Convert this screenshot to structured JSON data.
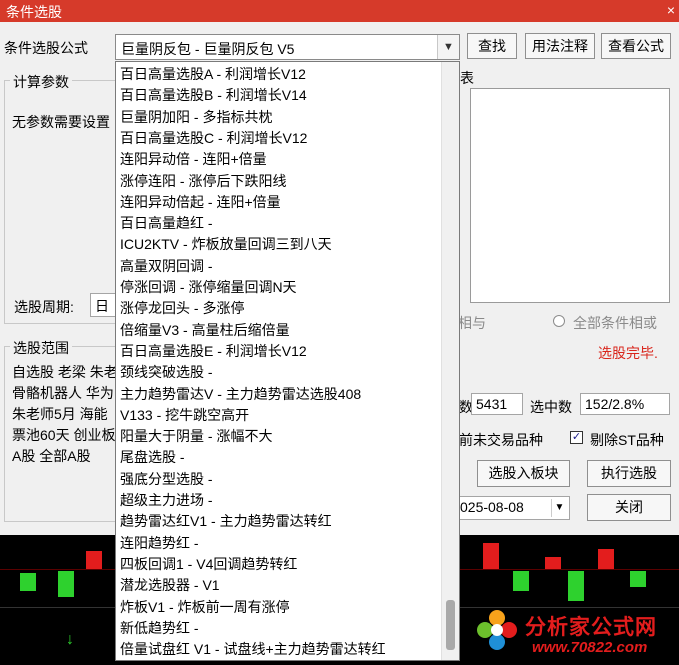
{
  "window": {
    "title": "条件选股",
    "close_glyph": "×"
  },
  "formula": {
    "label": "条件选股公式",
    "selected": "巨量阴反包  -  巨量阴反包 V5",
    "find_button": "查找",
    "usage_button": "用法注释",
    "view_button": "查看公式"
  },
  "params": {
    "group_title": "计算参数",
    "no_params_text": "无参数需要设置",
    "tail_char": "表"
  },
  "period": {
    "label": "选股周期:",
    "value": "日线"
  },
  "condition_mode": {
    "and_label": "相与",
    "or_label": "全部条件相或"
  },
  "status": {
    "done_text": "选股完毕."
  },
  "range": {
    "group_title": "选股范围",
    "rows": [
      "自选股  老梁  朱老",
      "骨骼机器人  华为",
      "朱老师5月  海能",
      "票池60天  创业板",
      "A股  全部A股"
    ]
  },
  "stats": {
    "total_label": "数",
    "total_value": "5431",
    "selected_label": "选中数",
    "selected_value": "152/2.8%"
  },
  "options": {
    "exclude_untraded_label": "前未交易品种",
    "exclude_st_label": "剔除ST品种",
    "exclude_st_checked": "✓"
  },
  "actions": {
    "add_to_block": "选股入板块",
    "run": "执行选股",
    "close": "关闭"
  },
  "date": {
    "value": "025-08-08"
  },
  "dropdown": {
    "items": [
      "百日高量选股A  -  利润增长V12",
      "百日高量选股B  -  利润增长V14",
      "巨量阴加阳  -  多指标共枕",
      "百日高量选股C  -  利润增长V12",
      "连阳异动倍  -  连阳+倍量",
      "涨停连阳  -  涨停后下跌阳线",
      "连阳异动倍起  -  连阳+倍量",
      "百日高量趋红  -",
      "ICU2KTV  -  炸板放量回调三到八天",
      "高量双阴回调  -",
      "停涨回调  -  涨停缩量回调N天",
      "涨停龙回头  -  多涨停",
      "倍缩量V3  -  高量柱后缩倍量",
      "百日高量选股E  -  利润增长V12",
      "颈线突破选股  -",
      "主力趋势雷达V  -  主力趋势雷达选股408",
      "V133  -  挖牛跳空高开",
      "阳量大于阴量  -  涨幅不大",
      "尾盘选股  -",
      "强底分型选股  -",
      "超级主力进场  -",
      "趋势雷达红V1  -  主力趋势雷达转红",
      "连阳趋势红  -",
      "四板回调1  -  V4回调趋势转红",
      "潜龙选股器  -  V1",
      "炸板V1  -  炸板前一周有涨停",
      "新低趋势红  -",
      "倍量试盘红 V1  -  试盘线+主力趋势雷达转红"
    ]
  },
  "watermark": {
    "brand": "分析家公式网",
    "url": "www.70822.com"
  },
  "icons": {
    "dropdown_arrow": "chevron-down-icon",
    "logo": "flower-logo-icon"
  }
}
